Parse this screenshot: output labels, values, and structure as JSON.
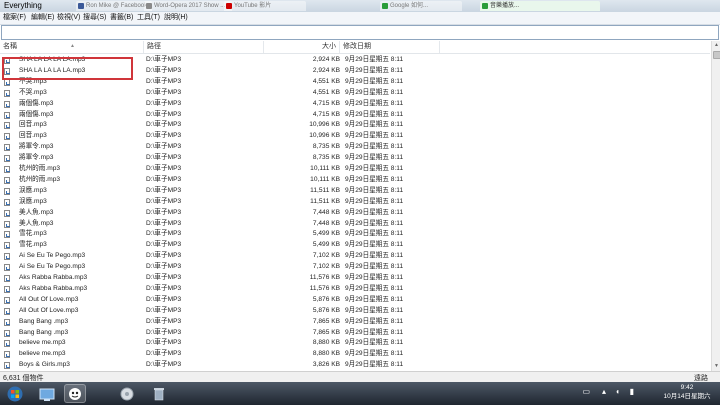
{
  "window": {
    "title": "Everything",
    "tabs": [
      {
        "label": "Ron Mike @ Facebook",
        "color": "#3b5998"
      },
      {
        "label": "Word-Opera 2017 Show ...",
        "color": "#8a8a8a"
      },
      {
        "label": "YouTube 影片",
        "color": "#c00"
      },
      {
        "label": "Google 如何...",
        "color": "#2a9d3a"
      },
      {
        "label": "音樂播放...",
        "color": "#2a9d3a"
      }
    ]
  },
  "menu": [
    "檔案(F)",
    "編輯(E)",
    "檢視(V)",
    "搜尋(S)",
    "書籤(B)",
    "工具(T)",
    "說明(H)"
  ],
  "search": {
    "value": "",
    "placeholder": ""
  },
  "columns": {
    "name": "名稱",
    "path": "路徑",
    "size": "大小",
    "date": "修改日期"
  },
  "files": [
    {
      "name": "SHA LA LA LA LA.mp3",
      "path": "D:\\車子MP3",
      "size": "2,924 KB",
      "date": "9月29日星期五 8:11"
    },
    {
      "name": "SHA LA LA LA LA.mp3",
      "path": "D:\\車子MP3",
      "size": "2,924 KB",
      "date": "9月29日星期五 8:11"
    },
    {
      "name": "不哭.mp3",
      "path": "D:\\車子MP3",
      "size": "4,551 KB",
      "date": "9月29日星期五 8:11"
    },
    {
      "name": "不哭.mp3",
      "path": "D:\\車子MP3",
      "size": "4,551 KB",
      "date": "9月29日星期五 8:11"
    },
    {
      "name": "兩個傷.mp3",
      "path": "D:\\車子MP3",
      "size": "4,715 KB",
      "date": "9月29日星期五 8:11"
    },
    {
      "name": "兩個傷.mp3",
      "path": "D:\\車子MP3",
      "size": "4,715 KB",
      "date": "9月29日星期五 8:11"
    },
    {
      "name": "回音.mp3",
      "path": "D:\\車子MP3",
      "size": "10,996 KB",
      "date": "9月29日星期五 8:11"
    },
    {
      "name": "回音.mp3",
      "path": "D:\\車子MP3",
      "size": "10,996 KB",
      "date": "9月29日星期五 8:11"
    },
    {
      "name": "將軍令.mp3",
      "path": "D:\\車子MP3",
      "size": "8,735 KB",
      "date": "9月29日星期五 8:11"
    },
    {
      "name": "將軍令.mp3",
      "path": "D:\\車子MP3",
      "size": "8,735 KB",
      "date": "9月29日星期五 8:11"
    },
    {
      "name": "杭州的雨.mp3",
      "path": "D:\\車子MP3",
      "size": "10,111 KB",
      "date": "9月29日星期五 8:11"
    },
    {
      "name": "杭州的雨.mp3",
      "path": "D:\\車子MP3",
      "size": "10,111 KB",
      "date": "9月29日星期五 8:11"
    },
    {
      "name": "淚應.mp3",
      "path": "D:\\車子MP3",
      "size": "11,511 KB",
      "date": "9月29日星期五 8:11"
    },
    {
      "name": "淚應.mp3",
      "path": "D:\\車子MP3",
      "size": "11,511 KB",
      "date": "9月29日星期五 8:11"
    },
    {
      "name": "美人魚.mp3",
      "path": "D:\\車子MP3",
      "size": "7,448 KB",
      "date": "9月29日星期五 8:11"
    },
    {
      "name": "美人魚.mp3",
      "path": "D:\\車子MP3",
      "size": "7,448 KB",
      "date": "9月29日星期五 8:11"
    },
    {
      "name": "雪花.mp3",
      "path": "D:\\車子MP3",
      "size": "5,499 KB",
      "date": "9月29日星期五 8:11"
    },
    {
      "name": "雪花.mp3",
      "path": "D:\\車子MP3",
      "size": "5,499 KB",
      "date": "9月29日星期五 8:11"
    },
    {
      "name": "Ai Se Eu Te Pego.mp3",
      "path": "D:\\車子MP3",
      "size": "7,102 KB",
      "date": "9月29日星期五 8:11"
    },
    {
      "name": "Ai Se Eu Te Pego.mp3",
      "path": "D:\\車子MP3",
      "size": "7,102 KB",
      "date": "9月29日星期五 8:11"
    },
    {
      "name": "Aks Rabba Rabba.mp3",
      "path": "D:\\車子MP3",
      "size": "11,576 KB",
      "date": "9月29日星期五 8:11"
    },
    {
      "name": "Aks Rabba Rabba.mp3",
      "path": "D:\\車子MP3",
      "size": "11,576 KB",
      "date": "9月29日星期五 8:11"
    },
    {
      "name": "All Out Of Love.mp3",
      "path": "D:\\車子MP3",
      "size": "5,876 KB",
      "date": "9月29日星期五 8:11"
    },
    {
      "name": "All Out Of Love.mp3",
      "path": "D:\\車子MP3",
      "size": "5,876 KB",
      "date": "9月29日星期五 8:11"
    },
    {
      "name": "Bang Bang .mp3",
      "path": "D:\\車子MP3",
      "size": "7,865 KB",
      "date": "9月29日星期五 8:11"
    },
    {
      "name": "Bang Bang .mp3",
      "path": "D:\\車子MP3",
      "size": "7,865 KB",
      "date": "9月29日星期五 8:11"
    },
    {
      "name": "believe me.mp3",
      "path": "D:\\車子MP3",
      "size": "8,880 KB",
      "date": "9月29日星期五 8:11"
    },
    {
      "name": "believe me.mp3",
      "path": "D:\\車子MP3",
      "size": "8,880 KB",
      "date": "9月29日星期五 8:11"
    },
    {
      "name": "Boys & Girls.mp3",
      "path": "D:\\車子MP3",
      "size": "3,826 KB",
      "date": "9月29日星期五 8:11"
    }
  ],
  "status": {
    "count": "6,631 個物件",
    "right": "遠路"
  },
  "taskbar": {
    "time": "9:42",
    "date": "10月14日星期六",
    "icons": [
      "windows-start-icon",
      "explorer-icon",
      "everything-app-icon",
      "media-player-icon",
      "recycle-bin-icon"
    ]
  },
  "colors": {
    "highlight": "#d0353a",
    "accent": "#3a6fb0"
  }
}
